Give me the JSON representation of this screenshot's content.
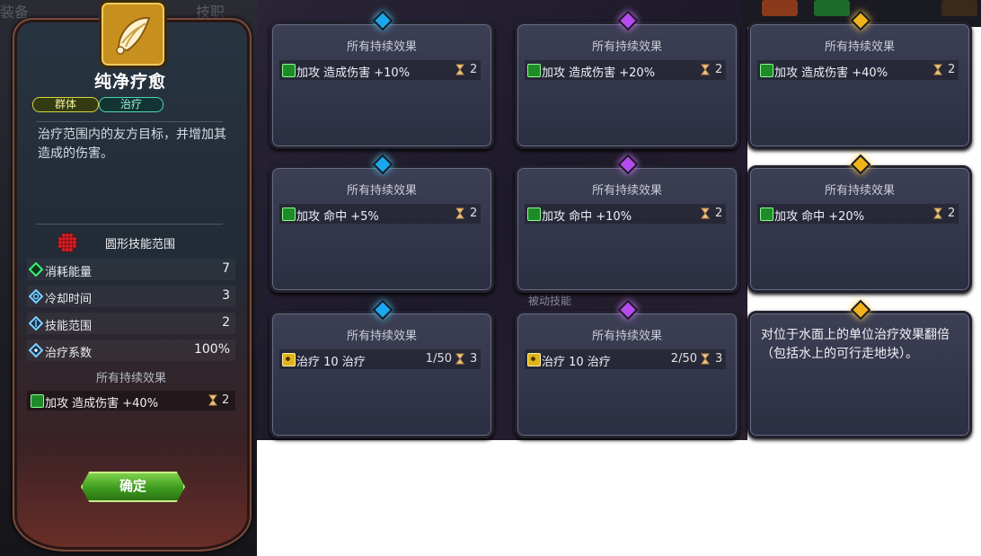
{
  "backdrop": {
    "ghost_left": "装备",
    "ghost_right": "技职",
    "ghost_passive": "被动技能"
  },
  "skill": {
    "name": "纯净疗愈",
    "tags": [
      "群体",
      "治疗"
    ],
    "description": "治疗范围内的友方目标，并增加其造成的伤害。",
    "range_shape": "圆形技能范围",
    "stats": [
      {
        "name": "消耗能量",
        "value": "7",
        "icon": "energy-icon"
      },
      {
        "name": "冷却时间",
        "value": "3",
        "icon": "cooldown-icon"
      },
      {
        "name": "技能范围",
        "value": "2",
        "icon": "range-icon"
      },
      {
        "name": "治疗系数",
        "value": "100%",
        "icon": "heal-coefficient-icon"
      }
    ],
    "persist_label": "所有持续效果",
    "effect": {
      "text": "加攻 造成伤害 +40%",
      "duration": "2"
    },
    "confirm_label": "确定"
  },
  "cards": [
    {
      "title": "所有持续效果",
      "gem": "blue",
      "effect": {
        "type": "attack",
        "text": "加攻 造成伤害 +10%",
        "duration": "2"
      }
    },
    {
      "title": "所有持续效果",
      "gem": "purple",
      "effect": {
        "type": "attack",
        "text": "加攻 造成伤害 +20%",
        "duration": "2"
      }
    },
    {
      "title": "所有持续效果",
      "gem": "gold",
      "effect": {
        "type": "attack",
        "text": "加攻 造成伤害 +40%",
        "duration": "2"
      }
    },
    {
      "title": "所有持续效果",
      "gem": "blue",
      "effect": {
        "type": "attack",
        "text": "加攻 命中 +5%",
        "duration": "2"
      }
    },
    {
      "title": "所有持续效果",
      "gem": "purple",
      "effect": {
        "type": "attack",
        "text": "加攻 命中 +10%",
        "duration": "2"
      }
    },
    {
      "title": "所有持续效果",
      "gem": "gold",
      "effect": {
        "type": "attack",
        "text": "加攻 命中 +20%",
        "duration": "2"
      }
    },
    {
      "title": "所有持续效果",
      "gem": "blue",
      "effect": {
        "type": "heal",
        "text": "治疗 10 治疗",
        "stack": "1/50",
        "duration": "3"
      }
    },
    {
      "title": "所有持续效果",
      "gem": "purple",
      "effect": {
        "type": "heal",
        "text": "治疗 10 治疗",
        "stack": "2/50",
        "duration": "3"
      }
    },
    {
      "gem": "gold",
      "description": "对位于水面上的单位治疗效果翻倍（包括水上的可行走地块）。"
    }
  ],
  "colors": {
    "gem_blue": "#1aa8f0",
    "gem_purple": "#b64cf0",
    "gem_gold": "#f0b41a",
    "confirm_green": "#3e9a1e"
  }
}
